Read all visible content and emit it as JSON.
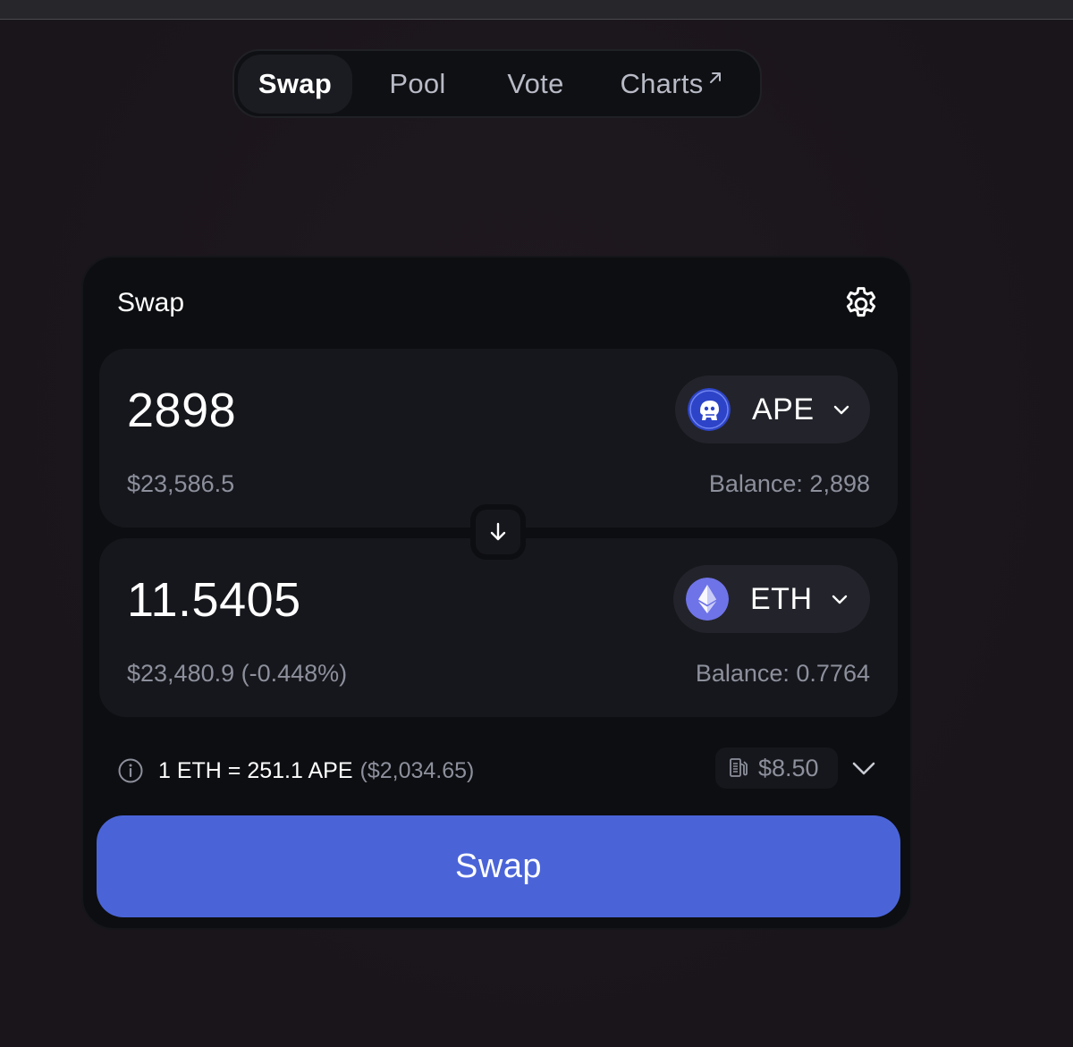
{
  "nav": {
    "items": [
      {
        "label": "Swap",
        "active": true
      },
      {
        "label": "Pool",
        "active": false
      },
      {
        "label": "Vote",
        "active": false
      },
      {
        "label": "Charts",
        "active": false,
        "external": true
      }
    ]
  },
  "card": {
    "title": "Swap",
    "settings_icon": "gear-icon"
  },
  "input_panel": {
    "amount": "2898",
    "usd_value": "$23,586.5",
    "balance": "Balance: 2,898",
    "token": {
      "symbol": "APE",
      "icon": "ape-token-icon",
      "color": "#2d44c8"
    }
  },
  "output_panel": {
    "amount": "11.5405",
    "usd_value": "$23,480.9 (-0.448%)",
    "balance": "Balance: 0.7764",
    "token": {
      "symbol": "ETH",
      "icon": "eth-token-icon",
      "color": "#6f73e8"
    }
  },
  "rate": {
    "text": "1 ETH = 251.1 APE",
    "usd": "($2,034.65)"
  },
  "gas": {
    "icon": "gas-pump-icon",
    "fee": "$8.50"
  },
  "swap_button": {
    "label": "Swap",
    "color": "#4a64d8"
  }
}
